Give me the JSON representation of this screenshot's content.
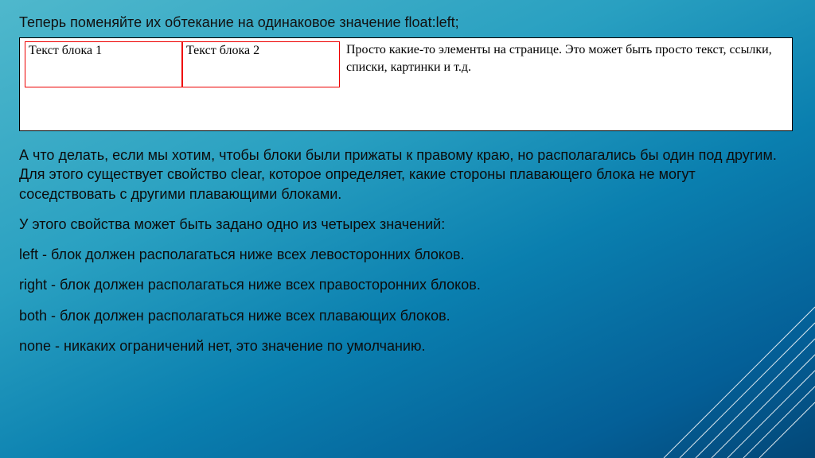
{
  "heading": "Теперь поменяйте их обтекание на одинаковое значение float:left;",
  "example": {
    "block1": "Текст блока 1",
    "block2": "Текст блока 2",
    "flow": "Просто какие-то элементы на странице. Это может быть просто текст, ссылки, списки, картинки и т.д."
  },
  "para1": "А что делать, если мы хотим, чтобы блоки были прижаты к правому краю, но располагались бы один под другим. Для этого существует свойство clear, которое определяет, какие стороны плавающего блока не могут соседствовать с другими плавающими блоками.",
  "para2": "У этого свойства может быть задано одно из четырех значений:",
  "opt_left": "left - блок должен располагаться ниже всех левосторонних блоков.",
  "opt_right": "right - блок должен располагаться ниже всех правосторонних блоков.",
  "opt_both": "both - блок должен располагаться ниже всех плавающих блоков.",
  "opt_none": "none - никаких ограничений нет, это значение по умолчанию."
}
